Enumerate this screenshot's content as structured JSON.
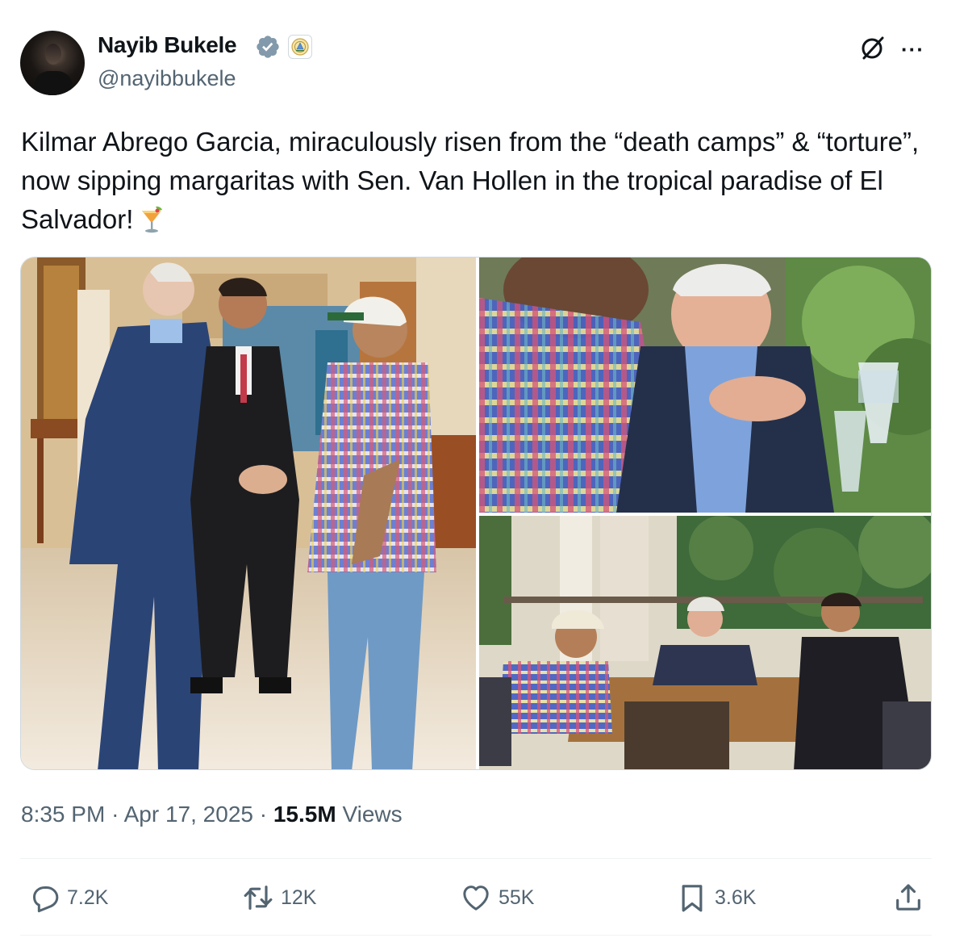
{
  "author": {
    "name": "Nayib Bukele",
    "handle": "@nayibbukele"
  },
  "tweet": {
    "text": "Kilmar Abrego Garcia, miraculously risen from the “death camps” & “torture”, now sipping margaritas with Sen. Van Hollen in the tropical paradise of El Salvador!",
    "emoji": "cocktail-glass-icon"
  },
  "meta": {
    "time": "8:35 PM",
    "date": "Apr 17, 2025",
    "views_count": "15.5M",
    "views_label": "Views",
    "separator": "·"
  },
  "actions": {
    "replies": "7.2K",
    "reposts": "12K",
    "likes": "55K",
    "bookmarks": "3.6K"
  },
  "colors": {
    "text": "#0f1419",
    "muted": "#536471",
    "verified": "#1d9bf0",
    "border": "#cfd9de"
  }
}
